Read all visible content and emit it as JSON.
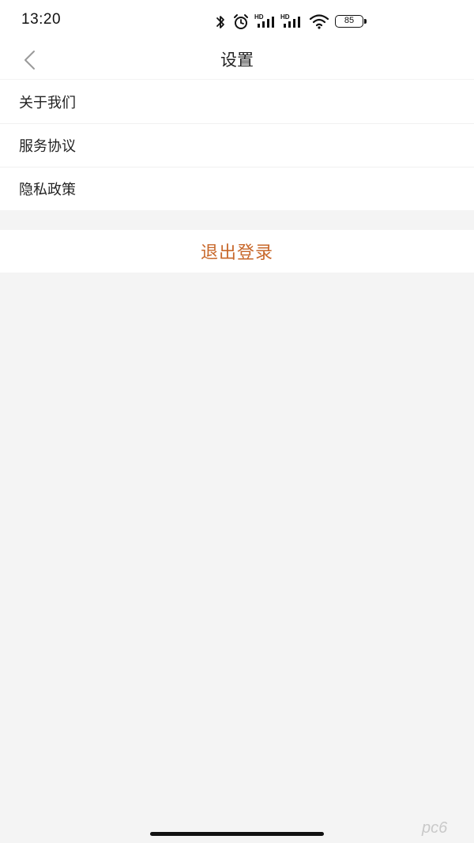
{
  "status_bar": {
    "time": "13:20",
    "icons": [
      "bluetooth-icon",
      "alarm-icon",
      "hd-signal-icon",
      "hd-signal-icon",
      "wifi-icon"
    ],
    "battery": "85"
  },
  "nav": {
    "back_icon": "chevron-left-icon",
    "title": "设置"
  },
  "menu": {
    "items": [
      {
        "label": "关于我们"
      },
      {
        "label": "服务协议"
      },
      {
        "label": "隐私政策"
      }
    ]
  },
  "logout": {
    "label": "退出登录",
    "color": "#c8682b"
  },
  "watermark": {
    "text": "pc6"
  }
}
